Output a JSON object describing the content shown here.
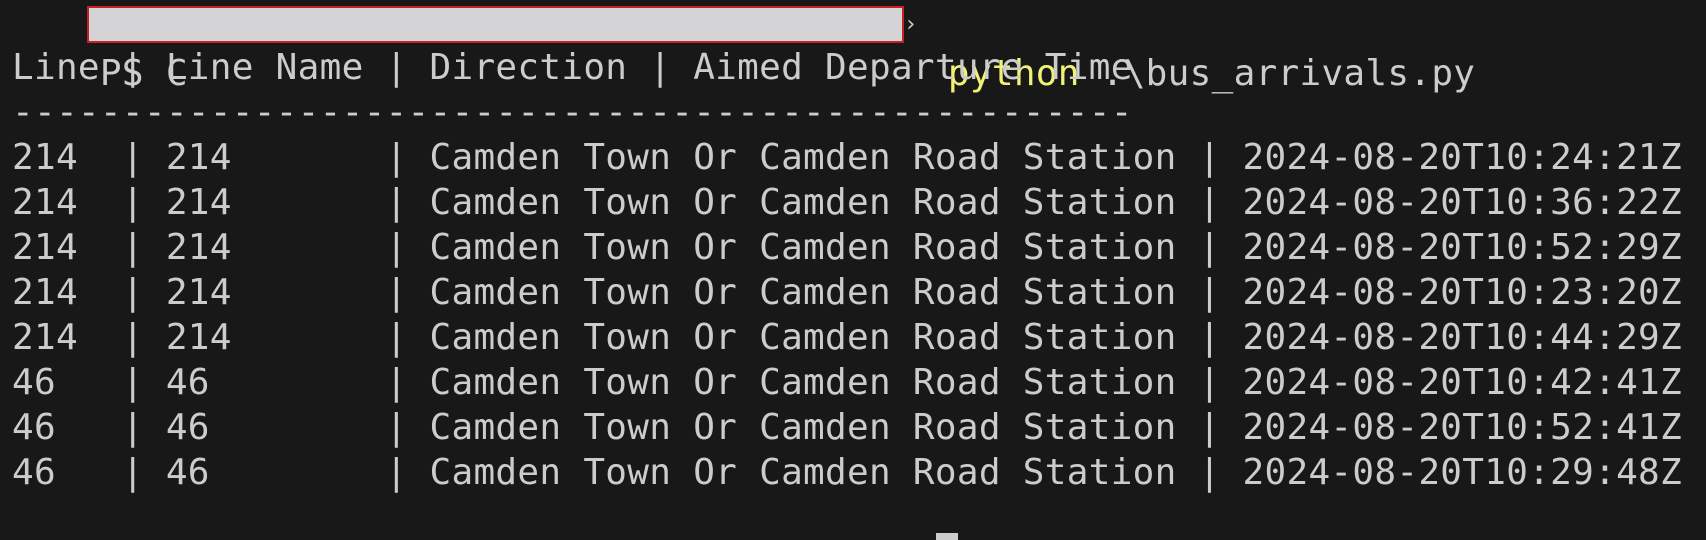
{
  "prompt": {
    "ps_label": "PS C",
    "chevron": "›",
    "command": "python",
    "argument": " .\\bus_arrivals.py"
  },
  "header": "Line | Line Name | Direction | Aimed Departure Time",
  "separator": "---------------------------------------------------",
  "rows": [
    "214  | 214       | Camden Town Or Camden Road Station | 2024-08-20T10:24:21Z",
    "214  | 214       | Camden Town Or Camden Road Station | 2024-08-20T10:36:22Z",
    "214  | 214       | Camden Town Or Camden Road Station | 2024-08-20T10:52:29Z",
    "214  | 214       | Camden Town Or Camden Road Station | 2024-08-20T10:23:20Z",
    "214  | 214       | Camden Town Or Camden Road Station | 2024-08-20T10:44:29Z",
    "46   | 46        | Camden Town Or Camden Road Station | 2024-08-20T10:42:41Z",
    "46   | 46        | Camden Town Or Camden Road Station | 2024-08-20T10:52:41Z",
    "46   | 46        | Camden Town Or Camden Road Station | 2024-08-20T10:29:48Z"
  ],
  "colors": {
    "background": "#181818",
    "foreground": "#cccccc",
    "command": "#f1f174",
    "redaction_fill": "#d4d4d6",
    "redaction_border": "#c42323"
  }
}
